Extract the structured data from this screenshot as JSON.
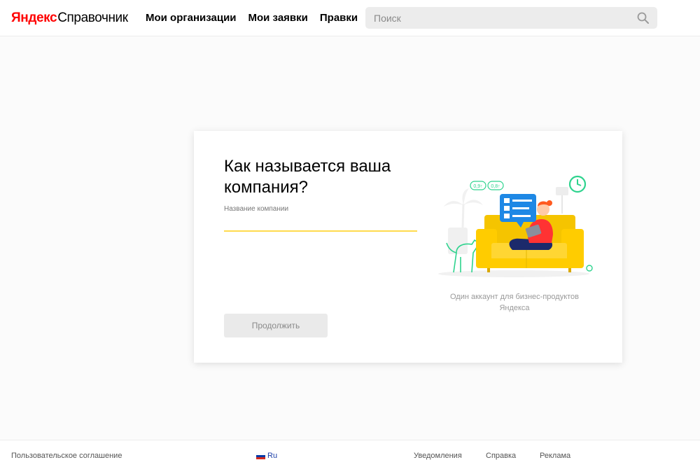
{
  "header": {
    "logo_brand": "Яндекс",
    "logo_service": "Справочник",
    "nav": [
      {
        "label": "Мои организации"
      },
      {
        "label": "Мои заявки"
      },
      {
        "label": "Правки"
      }
    ],
    "search": {
      "placeholder": "Поиск",
      "value": "",
      "icon": "search-icon"
    }
  },
  "card": {
    "title": "Как называется ваша компания?",
    "field_label": "Название компании",
    "field_value": "",
    "continue_label": "Продолжить",
    "illustration_badges": [
      "0,9↑",
      "0,8↑"
    ],
    "caption": "Один аккаунт для бизнес-продуктов Яндекса"
  },
  "footer": {
    "terms": "Пользовательское соглашение",
    "language": "Ru",
    "notifications": "Уведомления",
    "help": "Справка",
    "ads": "Реклама"
  },
  "colors": {
    "brand_red": "#ff0000",
    "accent_yellow": "#ffdb4d",
    "sofa_yellow": "#ffcc00",
    "illustration_green": "#2ed38e",
    "chat_blue": "#1e88e5"
  }
}
